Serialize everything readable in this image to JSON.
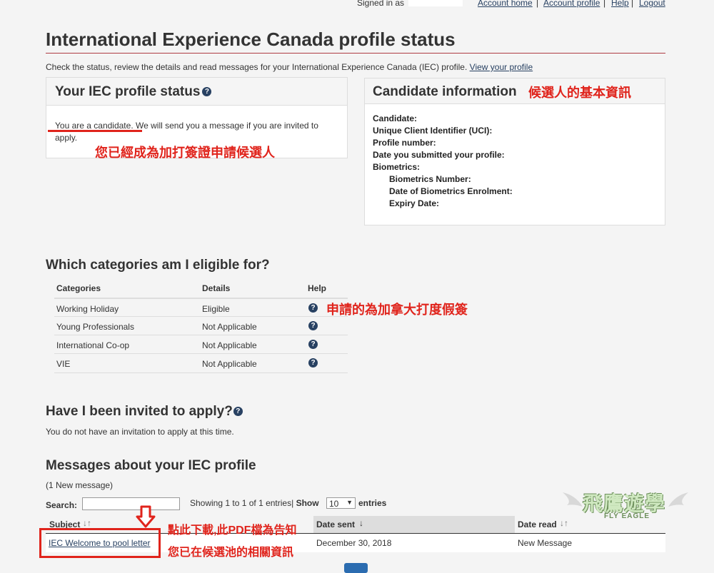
{
  "top_nav": {
    "signed_in": "Signed in as",
    "account_home": "Account home",
    "account_profile": "Account profile",
    "help": "Help",
    "logout": "Logout",
    "separator": "|"
  },
  "page": {
    "title": "International Experience Canada profile status",
    "intro": "Check the status, review the details and read messages for your International Experience Canada (IEC) profile.",
    "view_profile_link": "View your profile"
  },
  "status_panel": {
    "title": "Your IEC profile status",
    "help_glyph": "?",
    "status_part1": "You are a candidate.",
    "status_part2": " We will send you a message if you are invited to apply.",
    "annotation": "您已經成為加打簽證申請候選人"
  },
  "candidate_panel": {
    "title": "Candidate information",
    "annotation": "候選人的基本資訊",
    "candidate": "Candidate:",
    "uci": "Unique Client Identifier (UCI):",
    "profile_number": "Profile number:",
    "date_submitted": "Date you submitted your profile:",
    "biometrics": "Biometrics:",
    "biometrics_number": "Biometrics Number:",
    "biometrics_date": "Date of Biometrics Enrolment:",
    "expiry_date": "Expiry Date:"
  },
  "categories": {
    "heading": "Which categories am I eligible for?",
    "headers": [
      "Categories",
      "Details",
      "Help"
    ],
    "rows": [
      {
        "category": "Working Holiday",
        "details": "Eligible"
      },
      {
        "category": "Young Professionals",
        "details": "Not Applicable"
      },
      {
        "category": "International Co-op",
        "details": "Not Applicable"
      },
      {
        "category": "VIE",
        "details": "Not Applicable"
      }
    ],
    "help_glyph": "?",
    "annotation": "申請的為加拿大打度假簽"
  },
  "invited": {
    "heading": "Have I been invited to apply?",
    "help_glyph": "?",
    "text": "You do not have an invitation to apply at this time."
  },
  "messages": {
    "heading": "Messages about your IEC profile",
    "count": "(1 New message)",
    "search_label": "Search:",
    "search_value": "",
    "showing": "Showing 1 to 1 of 1 entries",
    "sep": "|",
    "show_label": "Show",
    "show_value": "10",
    "entries_label": "entries",
    "headers": {
      "subject": "Subject",
      "date_sent": "Date sent",
      "date_read": "Date read"
    },
    "sort_glyph_both": "↓↑",
    "sort_glyph_down": "↓",
    "rows": [
      {
        "subject": "IEC Welcome to pool letter",
        "date_sent": "December 30, 2018",
        "date_read": "New Message"
      }
    ],
    "annotation_line1": "點此下載,此PDF檔為告知",
    "annotation_line2": "您已在候選池的相關資訊"
  },
  "watermark": {
    "text_main": "飛鷹遊學",
    "text_sub": "FLY EAGLE"
  },
  "colors": {
    "accent_red": "#af3c43",
    "annotation_red": "#e0241c",
    "link_blue": "#284162"
  }
}
